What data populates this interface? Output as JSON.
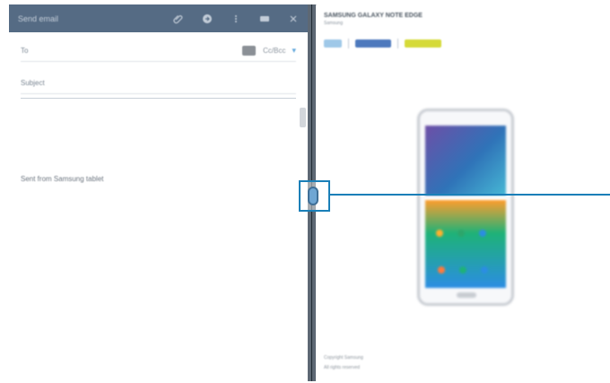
{
  "compose": {
    "title": "Send email",
    "to_placeholder": "To",
    "cc_label": "Cc/Bcc",
    "subject_placeholder": "Subject",
    "signature": "Sent from Samsung tablet",
    "icons": [
      "attach-icon",
      "send-icon",
      "more-icon",
      "keyboard-icon",
      "close-icon"
    ]
  },
  "web": {
    "title": "SAMSUNG GALAXY NOTE EDGE",
    "subtitle": "Samsung",
    "chips": [
      "chip",
      "chip",
      "chip"
    ],
    "footer_1": "Copyright Samsung",
    "footer_2": "All rights reserved"
  },
  "colors": {
    "compose_bar": "#556b84",
    "splitter": "#5d6874",
    "callout": "#1a7fb8",
    "handle": "#6fa6d3",
    "chip_blue": "#4d79bd",
    "chip_yellow": "#d5da38"
  }
}
